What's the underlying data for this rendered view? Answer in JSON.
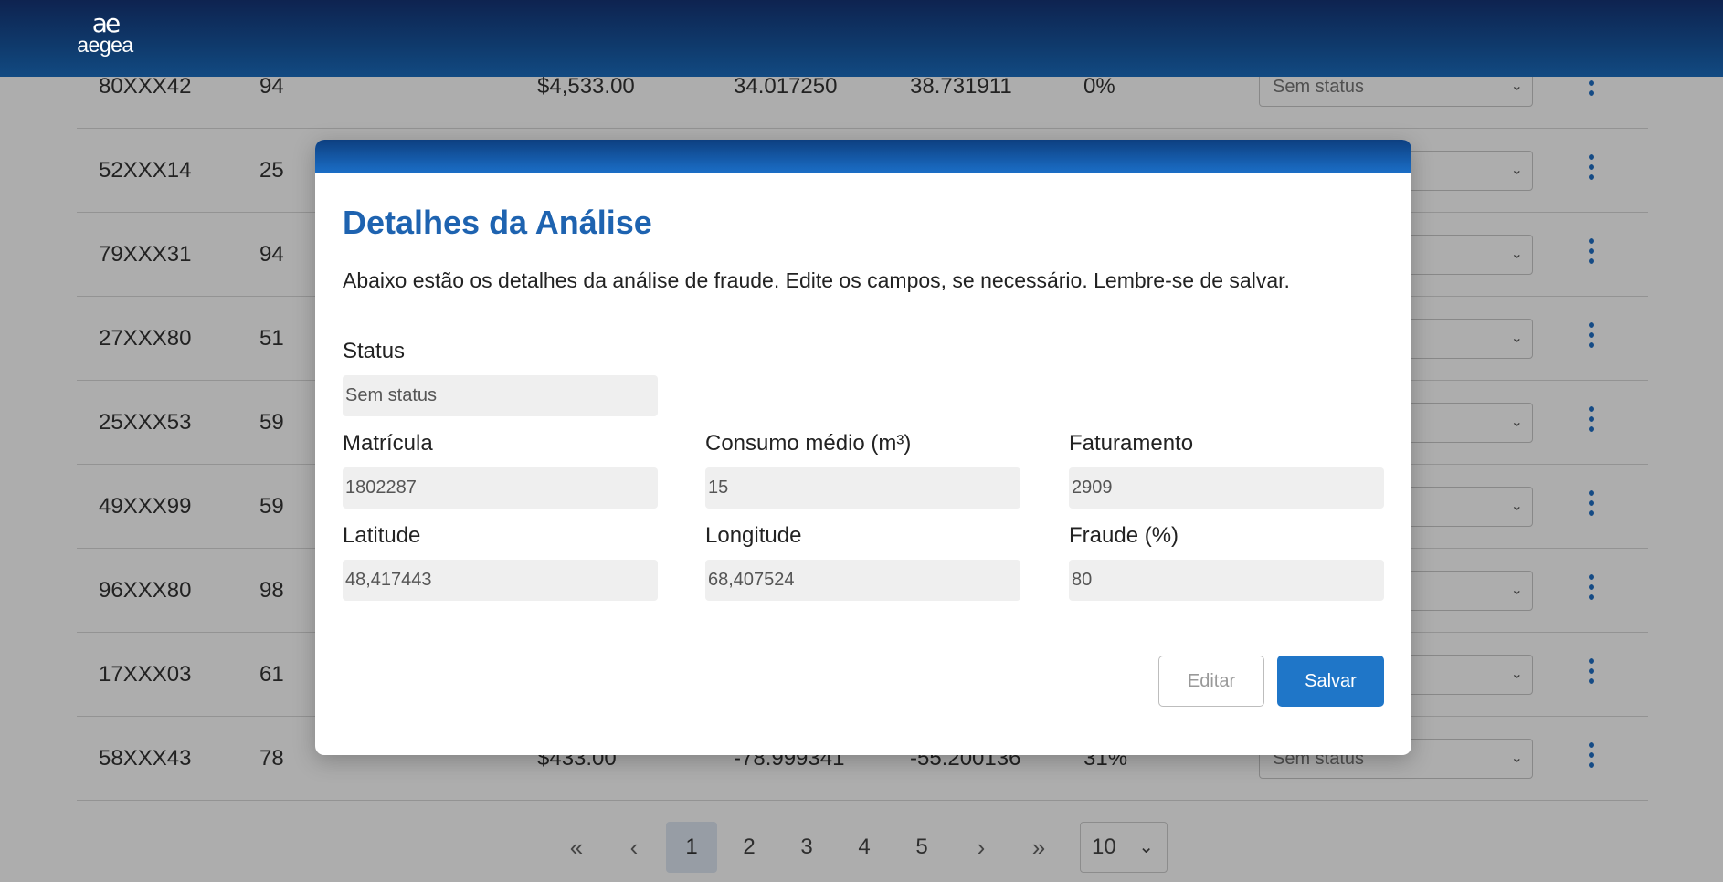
{
  "header": {
    "logo_mark": "ae",
    "logo_word": "aegea"
  },
  "table": {
    "rows": [
      {
        "id": "80XXX42",
        "consumo": "94",
        "faturamento": "$4,533.00",
        "latitude": "34.017250",
        "longitude": "38.731911",
        "fraude": "0%",
        "status": "Sem status"
      },
      {
        "id": "52XXX14",
        "consumo": "25"
      },
      {
        "id": "79XXX31",
        "consumo": "94"
      },
      {
        "id": "27XXX80",
        "consumo": "51"
      },
      {
        "id": "25XXX53",
        "consumo": "59"
      },
      {
        "id": "49XXX99",
        "consumo": "59"
      },
      {
        "id": "96XXX80",
        "consumo": "98"
      },
      {
        "id": "17XXX03",
        "consumo": "61"
      },
      {
        "id": "58XXX43",
        "consumo": "78",
        "faturamento": "$433.00",
        "latitude": "-78.999341",
        "longitude": "-55.200136",
        "fraude": "31%",
        "status": "Sem status"
      }
    ]
  },
  "pagination": {
    "first": "«",
    "prev": "‹",
    "next": "›",
    "last": "»",
    "pages": [
      "1",
      "2",
      "3",
      "4",
      "5"
    ],
    "active_page": "1",
    "per_page": "10"
  },
  "modal": {
    "title": "Detalhes da Análise",
    "description": "Abaixo estão os detalhes da análise de fraude. Edite os campos, se necessário. Lembre-se de salvar.",
    "status_label": "Status",
    "status_value": "Sem status",
    "matricula_label": "Matrícula",
    "matricula_value": "1802287",
    "consumo_label": "Consumo médio (m³)",
    "consumo_value": "15",
    "faturamento_label": "Faturamento",
    "faturamento_value": "2909",
    "latitude_label": "Latitude",
    "latitude_value": "48,417443",
    "longitude_label": "Longitude",
    "longitude_value": "68,407524",
    "fraude_label": "Fraude (%)",
    "fraude_value": "80",
    "edit_label": "Editar",
    "save_label": "Salvar"
  },
  "colors": {
    "accent": "#1e63b0",
    "save_button": "#1f76c8",
    "header": "#0e2350"
  }
}
